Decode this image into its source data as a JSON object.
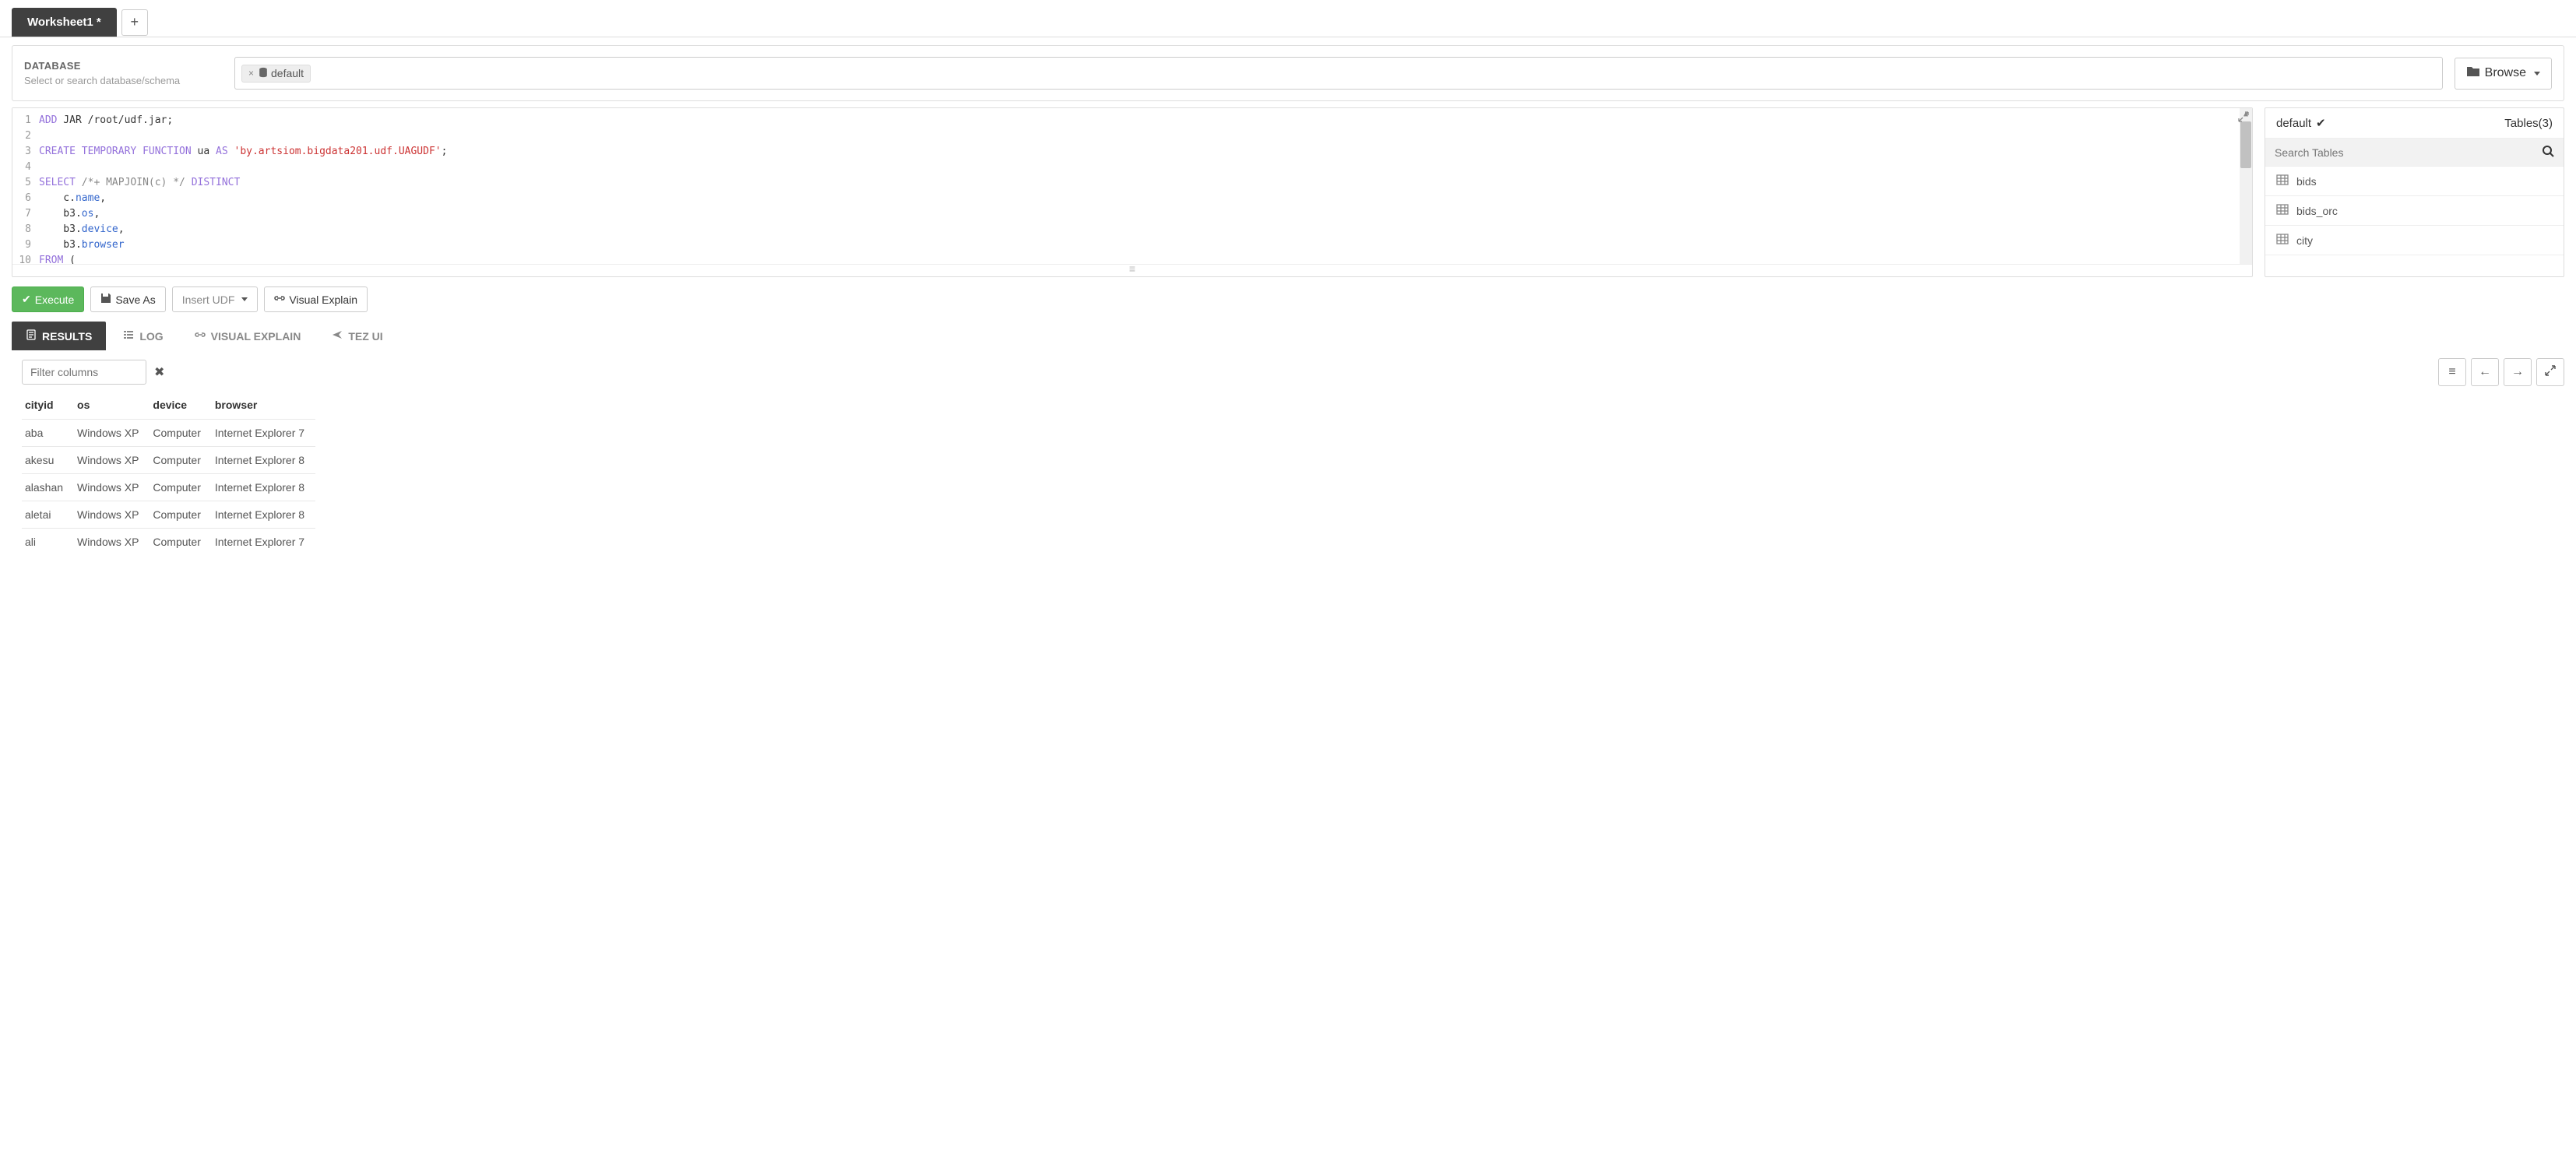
{
  "worksheet": {
    "tab_label": "Worksheet1 *"
  },
  "database": {
    "label": "DATABASE",
    "help": "Select or search database/schema",
    "selected": "default",
    "browse": "Browse"
  },
  "editor": {
    "gutter": [
      "1",
      "2",
      "3",
      "4",
      "5",
      "6",
      "7",
      "8",
      "9",
      "10"
    ]
  },
  "tables_panel": {
    "db_name": "default",
    "tables_label": "Tables(3)",
    "search_placeholder": "Search Tables",
    "items": [
      "bids",
      "bids_orc",
      "city"
    ]
  },
  "actions": {
    "execute": "Execute",
    "save_as": "Save As",
    "insert_udf": "Insert UDF",
    "visual_explain": "Visual Explain"
  },
  "result_tabs": {
    "results": "RESULTS",
    "log": "LOG",
    "visual_explain": "VISUAL EXPLAIN",
    "tez_ui": "TEZ UI"
  },
  "results": {
    "filter_placeholder": "Filter columns",
    "columns": [
      "cityid",
      "os",
      "device",
      "browser"
    ],
    "rows": [
      [
        "aba",
        "Windows XP",
        "Computer",
        "Internet Explorer 7"
      ],
      [
        "akesu",
        "Windows XP",
        "Computer",
        "Internet Explorer 8"
      ],
      [
        "alashan",
        "Windows XP",
        "Computer",
        "Internet Explorer 8"
      ],
      [
        "aletai",
        "Windows XP",
        "Computer",
        "Internet Explorer 8"
      ],
      [
        "ali",
        "Windows XP",
        "Computer",
        "Internet Explorer 7"
      ]
    ]
  }
}
